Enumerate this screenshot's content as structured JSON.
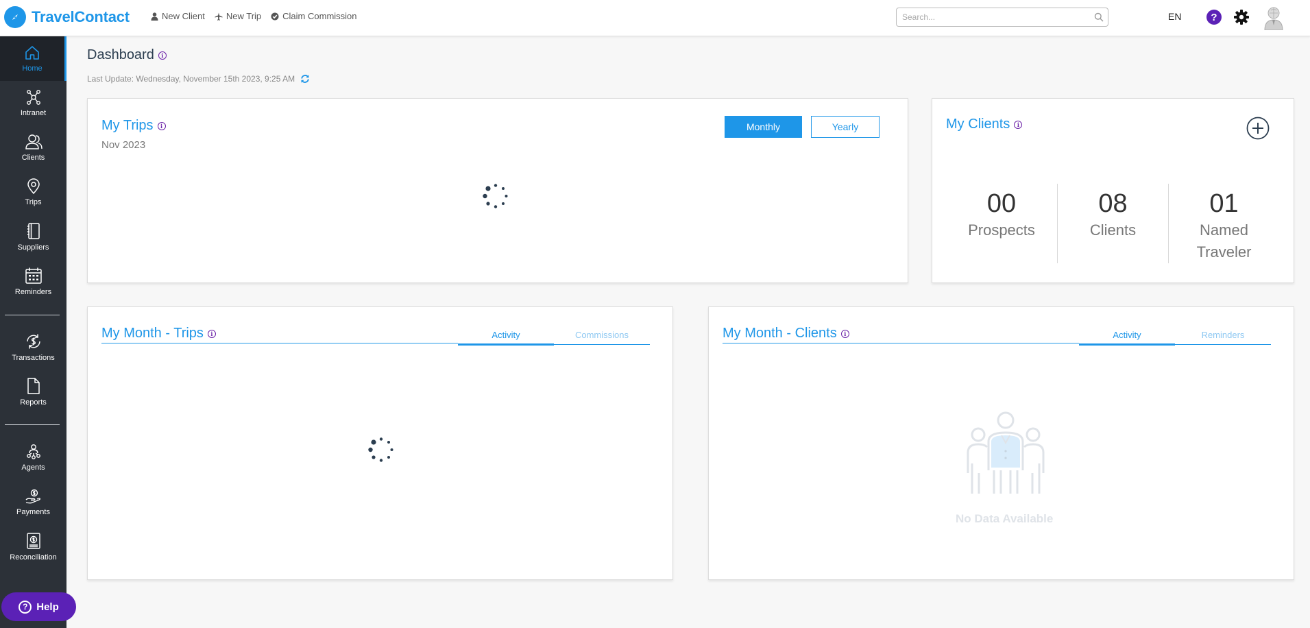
{
  "app": {
    "name": "TravelContact",
    "brand_color": "#1e96e8"
  },
  "topbar": {
    "quick_links": [
      {
        "label": "New Client",
        "icon": "user-icon"
      },
      {
        "label": "New Trip",
        "icon": "plane-icon"
      },
      {
        "label": "Claim Commission",
        "icon": "check-circle-icon"
      }
    ],
    "search_placeholder": "Search...",
    "language": "EN"
  },
  "sidebar": {
    "items": [
      {
        "label": "Home",
        "icon": "home-icon",
        "active": true
      },
      {
        "label": "Intranet",
        "icon": "network-icon"
      },
      {
        "label": "Clients",
        "icon": "clients-icon"
      },
      {
        "label": "Trips",
        "icon": "map-pin-icon"
      },
      {
        "label": "Suppliers",
        "icon": "book-icon"
      },
      {
        "label": "Reminders",
        "icon": "calendar-icon"
      },
      {
        "label": "Transactions",
        "icon": "dollar-cycle-icon"
      },
      {
        "label": "Reports",
        "icon": "document-icon"
      },
      {
        "label": "Agents",
        "icon": "agents-icon"
      },
      {
        "label": "Payments",
        "icon": "hand-money-icon"
      },
      {
        "label": "Reconciliation",
        "icon": "reconciliation-icon"
      }
    ],
    "help_label": "Help"
  },
  "dashboard": {
    "title": "Dashboard",
    "last_update": "Last Update: Wednesday, November 15th 2023, 9:25 AM"
  },
  "my_trips": {
    "title": "My Trips",
    "period": "Nov 2023",
    "monthly_label": "Monthly",
    "yearly_label": "Yearly"
  },
  "my_clients": {
    "title": "My Clients",
    "stats": [
      {
        "value": "00",
        "label": "Prospects"
      },
      {
        "value": "08",
        "label": "Clients"
      },
      {
        "value": "01",
        "label": "Named Traveler"
      }
    ]
  },
  "month_trips": {
    "title": "My Month - Trips",
    "tabs": [
      {
        "label": "Activity",
        "active": true
      },
      {
        "label": "Commissions"
      }
    ]
  },
  "month_clients": {
    "title": "My Month - Clients",
    "tabs": [
      {
        "label": "Activity",
        "active": true
      },
      {
        "label": "Reminders"
      }
    ],
    "empty_text": "No Data Available"
  }
}
